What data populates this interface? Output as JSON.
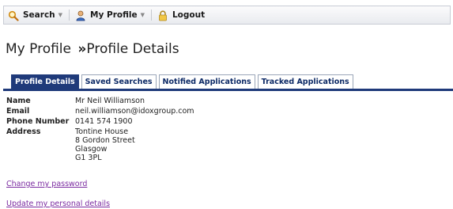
{
  "toolbar": {
    "search_label": "Search",
    "my_profile_label": "My Profile",
    "logout_label": "Logout"
  },
  "page": {
    "title_part1": "My Profile",
    "title_sep": "»",
    "title_part2": "Profile Details"
  },
  "tabs": [
    {
      "label": "Profile Details",
      "active": true
    },
    {
      "label": "Saved Searches",
      "active": false
    },
    {
      "label": "Notified Applications",
      "active": false
    },
    {
      "label": "Tracked Applications",
      "active": false
    }
  ],
  "profile": {
    "name_label": "Name",
    "name_value": "Mr Neil Williamson",
    "email_label": "Email",
    "email_value": "neil.williamson@idoxgroup.com",
    "phone_label": "Phone Number",
    "phone_value": "0141 574 1900",
    "address_label": "Address",
    "address_lines": [
      "Tontine House",
      "8 Gordon Street",
      "Glasgow",
      "G1 3PL"
    ]
  },
  "links": {
    "change_password": "Change my password",
    "update_details": "Update my personal details"
  },
  "colors": {
    "tab_active_bg": "#1f3a7a",
    "tab_text": "#0d2a66",
    "link": "#7a2aa0"
  }
}
